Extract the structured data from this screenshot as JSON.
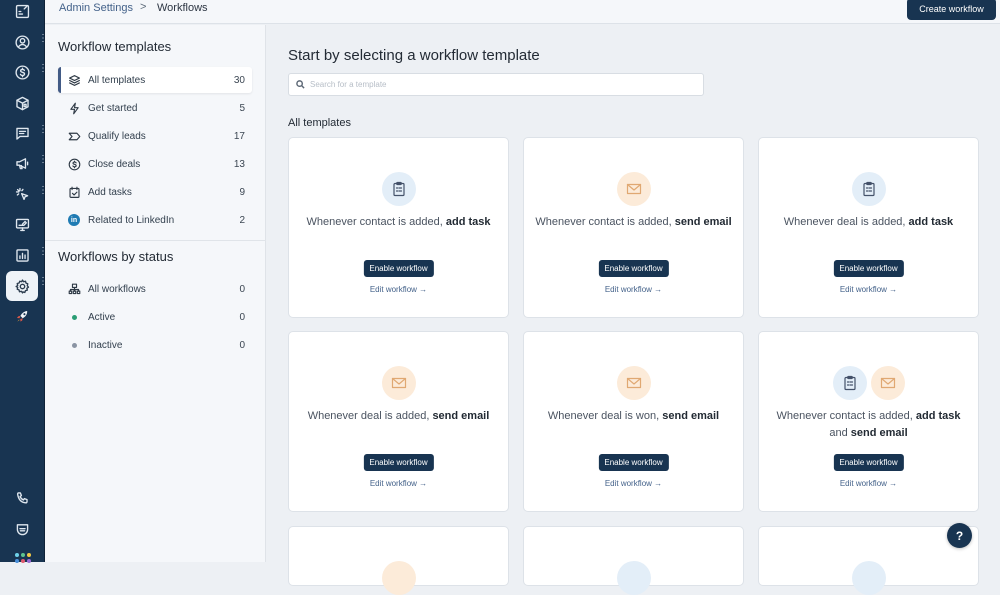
{
  "breadcrumb": {
    "parent": "Admin Settings",
    "separator": ">",
    "current": "Workflows"
  },
  "header": {
    "create_button": "Create workflow"
  },
  "rail": {
    "items": [
      {
        "icon": "dashboard-icon",
        "active": false,
        "has_menu": false
      },
      {
        "icon": "contact-icon",
        "active": false,
        "has_menu": true
      },
      {
        "icon": "dollar-icon",
        "active": false,
        "has_menu": true
      },
      {
        "icon": "product-box-icon",
        "active": false,
        "has_menu": false
      },
      {
        "icon": "chat-icon",
        "active": false,
        "has_menu": true
      },
      {
        "icon": "megaphone-icon",
        "active": false,
        "has_menu": true
      },
      {
        "icon": "cursor-click-icon",
        "active": false,
        "has_menu": true
      },
      {
        "icon": "monitor-edit-icon",
        "active": false,
        "has_menu": false
      },
      {
        "icon": "chart-icon",
        "active": false,
        "has_menu": true
      },
      {
        "icon": "gear-icon",
        "active": true,
        "has_menu": true
      },
      {
        "icon": "rocket-icon",
        "active": false,
        "has_menu": false
      }
    ],
    "bottom": [
      {
        "icon": "phone-icon"
      },
      {
        "icon": "message-icon"
      },
      {
        "icon": "apps-grid-icon"
      }
    ]
  },
  "sidebar": {
    "templates_title": "Workflow templates",
    "templates": [
      {
        "label": "All templates",
        "count": "30",
        "icon": "layers-icon",
        "active": true
      },
      {
        "label": "Get started",
        "count": "5",
        "icon": "lightning-icon",
        "active": false
      },
      {
        "label": "Qualify leads",
        "count": "17",
        "icon": "tag-icon",
        "active": false
      },
      {
        "label": "Close deals",
        "count": "13",
        "icon": "dollar-icon",
        "active": false
      },
      {
        "label": "Add tasks",
        "count": "9",
        "icon": "calendar-check-icon",
        "active": false
      },
      {
        "label": "Related to LinkedIn",
        "count": "2",
        "icon": "linkedin-icon",
        "active": false
      }
    ],
    "status_title": "Workflows by status",
    "statuses": [
      {
        "label": "All workflows",
        "count": "0",
        "icon": "hierarchy-icon"
      },
      {
        "label": "Active",
        "count": "0",
        "icon": "dot-icon",
        "color": "#2a9d74"
      },
      {
        "label": "Inactive",
        "count": "0",
        "icon": "dot-icon",
        "color": "#8a94a3"
      }
    ]
  },
  "main": {
    "title": "Start by selecting a workflow template",
    "search_placeholder": "Search for a template",
    "section_label": "All templates",
    "enable_label": "Enable workflow",
    "edit_label": "Edit workflow →",
    "cards": [
      {
        "prefix": "Whenever contact is added, ",
        "action": "add task",
        "joiner": "",
        "action2": "",
        "icons": [
          "task"
        ]
      },
      {
        "prefix": "Whenever contact is added, ",
        "action": "send email",
        "joiner": "",
        "action2": "",
        "icons": [
          "email"
        ]
      },
      {
        "prefix": "Whenever deal is added, ",
        "action": "add task",
        "joiner": "",
        "action2": "",
        "icons": [
          "task"
        ]
      },
      {
        "prefix": "Whenever deal is added, ",
        "action": "send email",
        "joiner": "",
        "action2": "",
        "icons": [
          "email"
        ]
      },
      {
        "prefix": "Whenever deal is won, ",
        "action": "send email",
        "joiner": "",
        "action2": "",
        "icons": [
          "email"
        ]
      },
      {
        "prefix": "Whenever contact is added, ",
        "action": "add task",
        "joiner": " and ",
        "action2": "send email",
        "icons": [
          "task",
          "email"
        ]
      }
    ]
  },
  "help_label": "?"
}
